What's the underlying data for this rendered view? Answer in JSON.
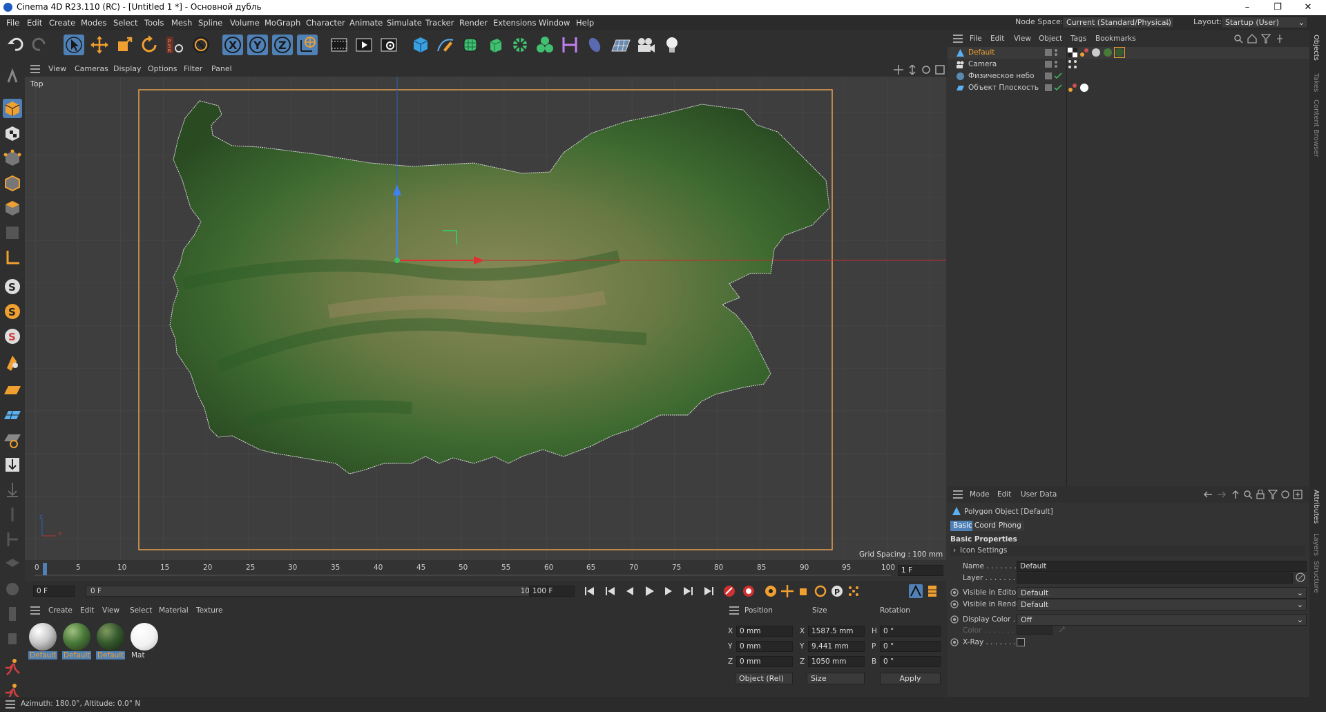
{
  "window": {
    "title": "Cinema 4D R23.110 (RC) - [Untitled 1 *] - Основной дубль",
    "min": "–",
    "max": "❐",
    "close": "✕"
  },
  "menu": [
    "File",
    "Edit",
    "Create",
    "Modes",
    "Select",
    "Tools",
    "Mesh",
    "Spline",
    "Volume",
    "MoGraph",
    "Character",
    "Animate",
    "Simulate",
    "Tracker",
    "Render",
    "Extensions",
    "Window",
    "Help"
  ],
  "node_space": {
    "label": "Node Space:",
    "value": "Current (Standard/Physical)"
  },
  "layout": {
    "label": "Layout:",
    "value": "Startup (User)"
  },
  "viewport": {
    "menu": [
      "View",
      "Cameras",
      "Display",
      "Options",
      "Filter",
      "Panel"
    ],
    "name": "Top",
    "grid_spacing": "Grid Spacing : 100 mm",
    "axis_x": "x",
    "axis_z": "z"
  },
  "timeline": {
    "ticks": [
      "0",
      "5",
      "10",
      "15",
      "20",
      "25",
      "30",
      "35",
      "40",
      "45",
      "50",
      "55",
      "60",
      "65",
      "70",
      "75",
      "80",
      "85",
      "90",
      "95",
      "100"
    ],
    "current_frame": "1 F"
  },
  "transport": {
    "start": "0 F",
    "range_start": "0 F",
    "range_end": "100 F",
    "end": "100 F"
  },
  "materials": {
    "menu": [
      "Create",
      "Edit",
      "View",
      "Select",
      "Material",
      "Texture"
    ],
    "items": [
      {
        "name": "Default",
        "color": "#c8c8c8"
      },
      {
        "name": "Default",
        "color": "#4a7a3a"
      },
      {
        "name": "Default",
        "color": "#355a2e"
      },
      {
        "name": "Mat",
        "color": "#f2f2f2"
      }
    ]
  },
  "coords": {
    "headers": [
      "Position",
      "Size",
      "Rotation"
    ],
    "rows": [
      {
        "axis": "X",
        "pos": "0 mm",
        "saxis": "X",
        "size": "1587.5 mm",
        "raxis": "H",
        "rot": "0 °"
      },
      {
        "axis": "Y",
        "pos": "0 mm",
        "saxis": "Y",
        "size": "9.441 mm",
        "raxis": "P",
        "rot": "0 °"
      },
      {
        "axis": "Z",
        "pos": "0 mm",
        "saxis": "Z",
        "size": "1050 mm",
        "raxis": "B",
        "rot": "0 °"
      }
    ],
    "mode": "Object (Rel)",
    "size_mode": "Size",
    "apply": "Apply"
  },
  "status": "Azimuth: 180.0°, Altitude: 0.0°  N",
  "objects": {
    "menu": [
      "File",
      "Edit",
      "View",
      "Object",
      "Tags",
      "Bookmarks"
    ],
    "items": [
      {
        "name": "Default",
        "selected": true
      },
      {
        "name": "Camera",
        "selected": false
      },
      {
        "name": "Физическое небо",
        "selected": false
      },
      {
        "name": "Объект Плоскость",
        "selected": false
      }
    ]
  },
  "attributes": {
    "menu": [
      "Mode",
      "Edit",
      "User Data"
    ],
    "object_title": "Polygon Object [Default]",
    "tabs": [
      "Basic",
      "Coord.",
      "Phong"
    ],
    "section": "Basic Properties",
    "icon_settings": "Icon Settings",
    "name_label": "Name . . . . . . . . .",
    "name_value": "Default",
    "layer_label": "Layer . . . . . . . . .",
    "vis_editor_label": "Visible in Editor . .",
    "vis_editor_value": "Default",
    "vis_render_label": "Visible in Renderer",
    "vis_render_value": "Default",
    "display_color_label": "Display Color . . . .",
    "display_color_value": "Off",
    "color_label": "Color . . . . . . . .",
    "xray_label": "X-Ray . . . . . . . . ."
  },
  "side_tabs": [
    "Objects",
    "Takes",
    "Content Browser",
    "Attributes",
    "Layers",
    "Structure"
  ],
  "colors": {
    "accent": "#4f81b6",
    "selected_text": "#f0a030",
    "frame": "#e6a050"
  }
}
